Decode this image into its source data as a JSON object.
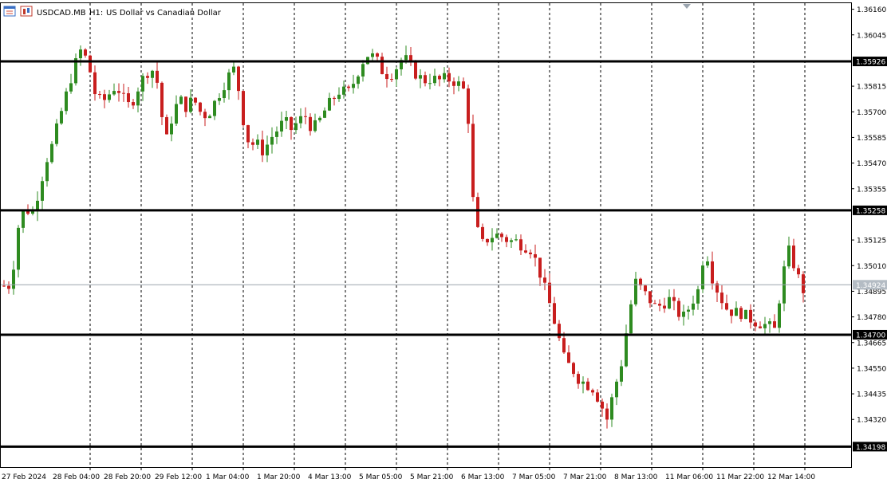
{
  "header": {
    "symbol": "USDCAD.MB",
    "timeframe": "H1:",
    "description": "US Dollar vs Canadian Dollar"
  },
  "colors": {
    "bull": "#2e8b20",
    "bear": "#c81e1e",
    "grid": "#000000",
    "level_line": "#000000",
    "current_price_line": "#9aa4ae",
    "label_fill": "#000000",
    "label_text": "#ffffff",
    "current_label_fill": "#b4bcc4",
    "axis_text": "#000000"
  },
  "chart_data": {
    "type": "candlestick",
    "title": "USDCAD.MB, H1: US Dollar vs Canadian Dollar",
    "ylim": [
      1.3416,
      1.3618
    ],
    "y_ticks": [
      1.3616,
      1.36045,
      1.35815,
      1.357,
      1.35585,
      1.3547,
      1.35355,
      1.35125,
      1.3501,
      1.34895,
      1.3478,
      1.34665,
      1.3455,
      1.34435,
      1.3432
    ],
    "x_ticks": [
      "27 Feb 2024",
      "28 Feb 04:00",
      "28 Feb 20:00",
      "29 Feb 12:00",
      "1 Mar 04:00",
      "1 Mar 20:00",
      "4 Mar 13:00",
      "5 Mar 05:00",
      "5 Mar 21:00",
      "6 Mar 13:00",
      "7 Mar 05:00",
      "7 Mar 21:00",
      "8 Mar 13:00",
      "11 Mar 06:00",
      "11 Mar 22:00",
      "12 Mar 14:00"
    ],
    "levels": [
      1.35926,
      1.35258,
      1.347,
      1.34198
    ],
    "current_price": 1.34924,
    "grid": "vertical dashed",
    "price_path": [
      1.3492,
      1.3492,
      1.3518,
      1.3527,
      1.3524,
      1.3535,
      1.3548,
      1.3556,
      1.3568,
      1.3579,
      1.359,
      1.3598,
      1.3592,
      1.3578,
      1.3574,
      1.3578,
      1.3582,
      1.3576,
      1.3572,
      1.358,
      1.3586,
      1.359,
      1.3582,
      1.3555,
      1.3568,
      1.3576,
      1.3572,
      1.3576,
      1.357,
      1.3568,
      1.3574,
      1.358,
      1.3586,
      1.359,
      1.3568,
      1.3555,
      1.3556,
      1.3552,
      1.3558,
      1.3562,
      1.3566,
      1.3562,
      1.3566,
      1.3568,
      1.3562,
      1.3566,
      1.3572,
      1.3576,
      1.358,
      1.3578,
      1.3584,
      1.3592,
      1.3596,
      1.3594,
      1.3588,
      1.3586,
      1.359,
      1.3595,
      1.359,
      1.3586,
      1.3584,
      1.3585,
      1.3584,
      1.3585,
      1.3584,
      1.3582,
      1.3578,
      1.3525,
      1.351,
      1.3513,
      1.3515,
      1.3514,
      1.3512,
      1.3512,
      1.351,
      1.3509,
      1.3502,
      1.3492,
      1.3482,
      1.347,
      1.3458,
      1.3455,
      1.345,
      1.3448,
      1.3446,
      1.344,
      1.3432,
      1.3445,
      1.3456,
      1.3476,
      1.3494,
      1.349,
      1.3486,
      1.3482,
      1.3484,
      1.3486,
      1.348,
      1.3478,
      1.3484,
      1.349,
      1.351,
      1.3496,
      1.3488,
      1.3482,
      1.348,
      1.348,
      1.3478,
      1.3476,
      1.3475,
      1.3474,
      1.3472,
      1.3496,
      1.3508,
      1.3498,
      1.349
    ]
  }
}
